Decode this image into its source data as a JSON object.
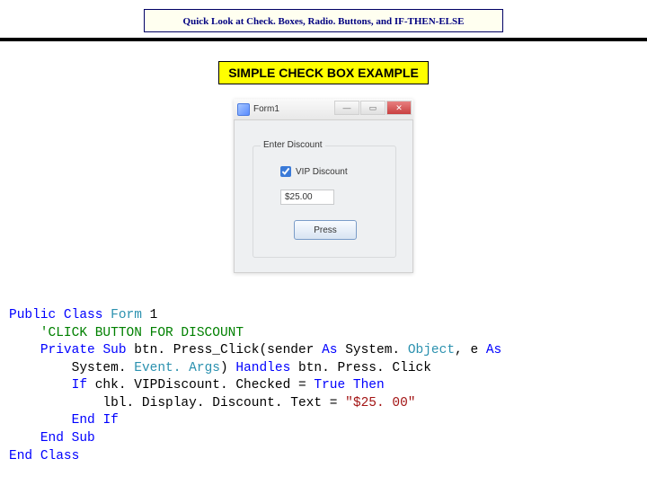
{
  "title": "Quick Look at Check. Boxes, Radio. Buttons, and IF-THEN-ELSE",
  "subtitle": "SIMPLE CHECK BOX EXAMPLE",
  "form": {
    "title": "Form1",
    "group_label": "Enter Discount",
    "checkbox_label": "VIP Discount",
    "checkbox_checked": true,
    "display_value": "$25.00",
    "button_label": "Press"
  },
  "code": {
    "l1a": "Public",
    "l1b": "Class",
    "l1c": "Form",
    "l1d": "1",
    "l2": "    'CLICK BUTTON FOR DISCOUNT",
    "l3a": "Private",
    "l3b": "Sub",
    "l3c": "btn. Press_Click(sender ",
    "l3d": "As",
    "l3e": "System. ",
    "l3f": "Object",
    "l3g": ", e ",
    "l3h": "As",
    "l4a": "System. ",
    "l4b": "Event. Args",
    "l4c": ") ",
    "l4d": "Handles",
    "l4e": " btn. Press. Click",
    "l5a": "If",
    "l5b": " chk. VIPDiscount. Checked = ",
    "l5c": "True",
    "l5d": "Then",
    "l6a": "lbl. Display. Discount. Text = ",
    "l6b": "\"$25. 00\"",
    "l7a": "End",
    "l7b": "If",
    "l8a": "End",
    "l8b": "Sub",
    "l9a": "End",
    "l9b": "Class"
  }
}
